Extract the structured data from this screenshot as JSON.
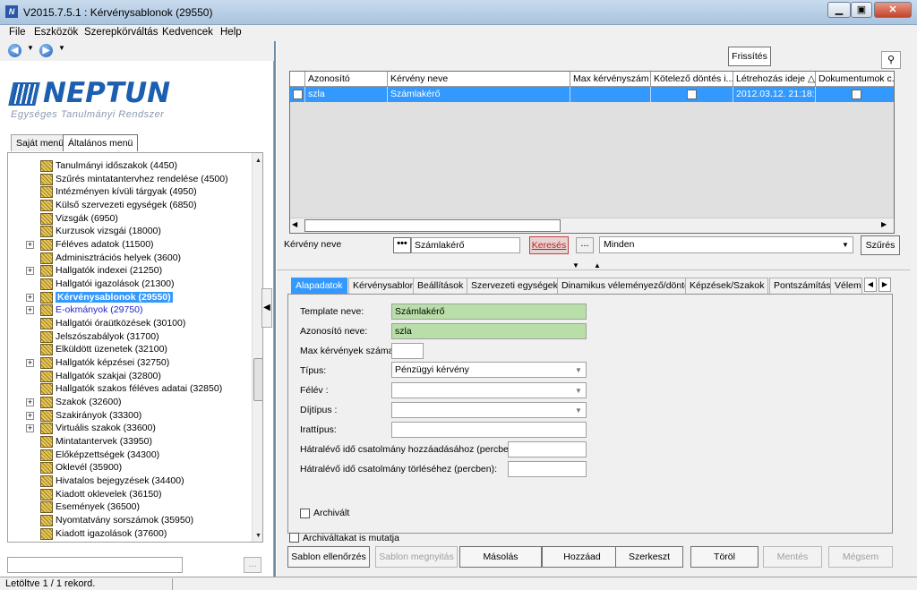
{
  "window": {
    "title": "V2015.7.5.1 : Kérvénysablonok (29550)",
    "icon": "N",
    "min": "▁",
    "max": "▣",
    "close": "✕"
  },
  "menu": [
    "File",
    "Eszközök",
    "Szerepkörváltás",
    "Kedvencek",
    "Help"
  ],
  "nav": {
    "back": "◀",
    "forward": "▶",
    "dropdown": "▼"
  },
  "logo": {
    "name": "NEPTUN",
    "subtitle": "Egységes Tanulmányi Rendszer"
  },
  "left_tabs": [
    "Saját menü",
    "Általános menü"
  ],
  "tree": [
    {
      "label": "Tanulmányi időszakok (4450)",
      "expander": ""
    },
    {
      "label": "Szűrés mintatantervhez rendelése (4500)",
      "expander": ""
    },
    {
      "label": "Intézményen kívüli tárgyak (4950)",
      "expander": ""
    },
    {
      "label": "Külső szervezeti egységek (6850)",
      "expander": ""
    },
    {
      "label": "Vizsgák (6950)",
      "expander": ""
    },
    {
      "label": "Kurzusok vizsgái (18000)",
      "expander": ""
    },
    {
      "label": "Féléves adatok (11500)",
      "expander": "+"
    },
    {
      "label": "Adminisztrációs helyek (3600)",
      "expander": ""
    },
    {
      "label": "Hallgatók indexei (21250)",
      "expander": "+"
    },
    {
      "label": "Hallgatói igazolások (21300)",
      "expander": ""
    },
    {
      "label": "Kérvénysablonok (29550)",
      "expander": "+",
      "selected": true
    },
    {
      "label": "E-okmányok (29750)",
      "expander": "+",
      "link": true
    },
    {
      "label": "Hallgatói óraütközések (30100)",
      "expander": ""
    },
    {
      "label": "Jelszószabályok (31700)",
      "expander": ""
    },
    {
      "label": "Elküldött üzenetek (32100)",
      "expander": ""
    },
    {
      "label": "Hallgatók képzései (32750)",
      "expander": "+"
    },
    {
      "label": "Hallgatók szakjai (32800)",
      "expander": ""
    },
    {
      "label": "Hallgatók szakos féléves adatai (32850)",
      "expander": ""
    },
    {
      "label": "Szakok (32600)",
      "expander": "+"
    },
    {
      "label": "Szakirányok (33300)",
      "expander": "+"
    },
    {
      "label": "Virtuális szakok (33600)",
      "expander": "+"
    },
    {
      "label": "Mintatantervek (33950)",
      "expander": ""
    },
    {
      "label": "Előképzettségek (34300)",
      "expander": ""
    },
    {
      "label": "Oklevél (35900)",
      "expander": ""
    },
    {
      "label": "Hivatalos bejegyzések (34400)",
      "expander": ""
    },
    {
      "label": "Kiadott oklevelek (36150)",
      "expander": ""
    },
    {
      "label": "Események (36500)",
      "expander": ""
    },
    {
      "label": "Nyomtatvány sorszámok (35950)",
      "expander": ""
    },
    {
      "label": "Kiadott igazolások (37600)",
      "expander": ""
    }
  ],
  "left_dots": "...",
  "splitter": "◀",
  "toolbar": {
    "refresh": "Frissítés",
    "pin": "⚲"
  },
  "grid": {
    "headers": [
      "Azonosító",
      "Kérvény neve",
      "Max kérvényszám",
      "Kötelező döntés i...",
      "Létrehozás ideje △",
      "Dokumentumok c..."
    ],
    "row": {
      "id": "szla",
      "name": "Számlakérő",
      "max": "",
      "created": "2012.03.12. 21:18:5"
    }
  },
  "search": {
    "label": "Kérvény neve",
    "dots": "•••",
    "value": "Számlakérő",
    "button": "Keresés",
    "dots2": "...",
    "filter": "Minden",
    "filter_button": "Szűrés"
  },
  "tabs": [
    "Alapadatok",
    "Kérvénysablon",
    "Beállítások",
    "Szervezeti egységek",
    "Dinamikus véleményező/döntő",
    "Képzések/Szakok",
    "Pontszámítás",
    "Vélemé..."
  ],
  "form": {
    "template_label": "Template neve:",
    "template_value": "Számlakérő",
    "id_label": "Azonosító neve:",
    "id_value": "szla",
    "max_label": "Max kérvények száma:",
    "max_value": "",
    "type_label": "Típus:",
    "type_value": "Pénzügyi kérvény",
    "semester_label": "Félév :",
    "semester_value": "",
    "fee_label": "Díjtípus :",
    "fee_value": "",
    "file_label": "Irattípus:",
    "file_value": "",
    "remain_add_label": "Hátralévő idő csatolmány hozzáadásához (percben):",
    "remain_add_value": "",
    "remain_del_label": "Hátralévő idő csatolmány törléséhez (percben):",
    "remain_del_value": "",
    "archived_label": "Archivált"
  },
  "show_archived": "Archiváltakat is mutatja",
  "buttons": [
    {
      "label": "Sablon ellenőrzés",
      "enabled": true
    },
    {
      "label": "Sablon megnyitás",
      "enabled": false
    },
    {
      "label": "Másolás",
      "enabled": true
    },
    {
      "label": "Hozzáad",
      "enabled": true
    },
    {
      "label": "Szerkeszt",
      "enabled": true
    },
    {
      "label": "Töröl",
      "enabled": true
    },
    {
      "label": "Mentés",
      "enabled": false
    },
    {
      "label": "Mégsem",
      "enabled": false
    }
  ],
  "status": "Letöltve 1 / 1 rekord."
}
